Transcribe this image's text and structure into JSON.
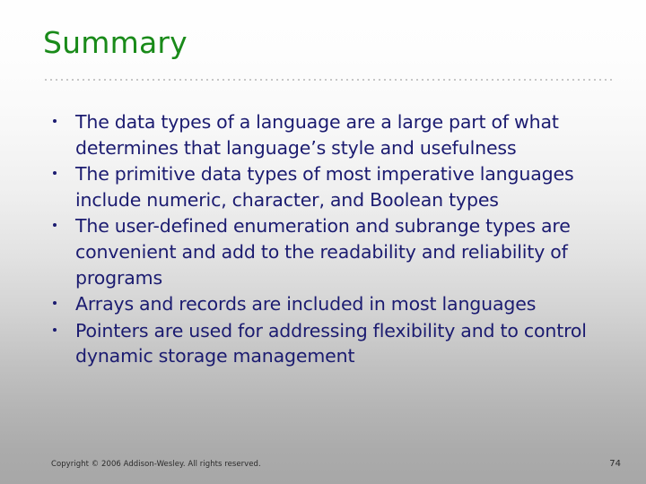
{
  "slide": {
    "title": "Summary",
    "title_color": "#198a19",
    "body_text_color": "#1b1b70",
    "background_top_color": "#fefefe",
    "background_bottom_color": "#a7a7a7"
  },
  "bullets": [
    {
      "marker": "bullet-dot",
      "text": "The data types of a language are a large part of what determines that language’s style and usefulness"
    },
    {
      "marker": "bullet-dot",
      "text": "The primitive data types of most imperative languages include numeric, character, and Boolean types"
    },
    {
      "marker": "bullet-dot",
      "text": "The user-defined enumeration and subrange types are convenient and add to the readability and reliability of programs"
    },
    {
      "marker": "bullet-dot",
      "text": "Arrays and records are included in most languages"
    },
    {
      "marker": "bullet-dot",
      "text": "Pointers are used for addressing flexibility and to control dynamic storage management"
    }
  ],
  "footer": {
    "copyright": "Copyright © 2006 Addison-Wesley. All rights reserved.",
    "page_number": "74"
  }
}
